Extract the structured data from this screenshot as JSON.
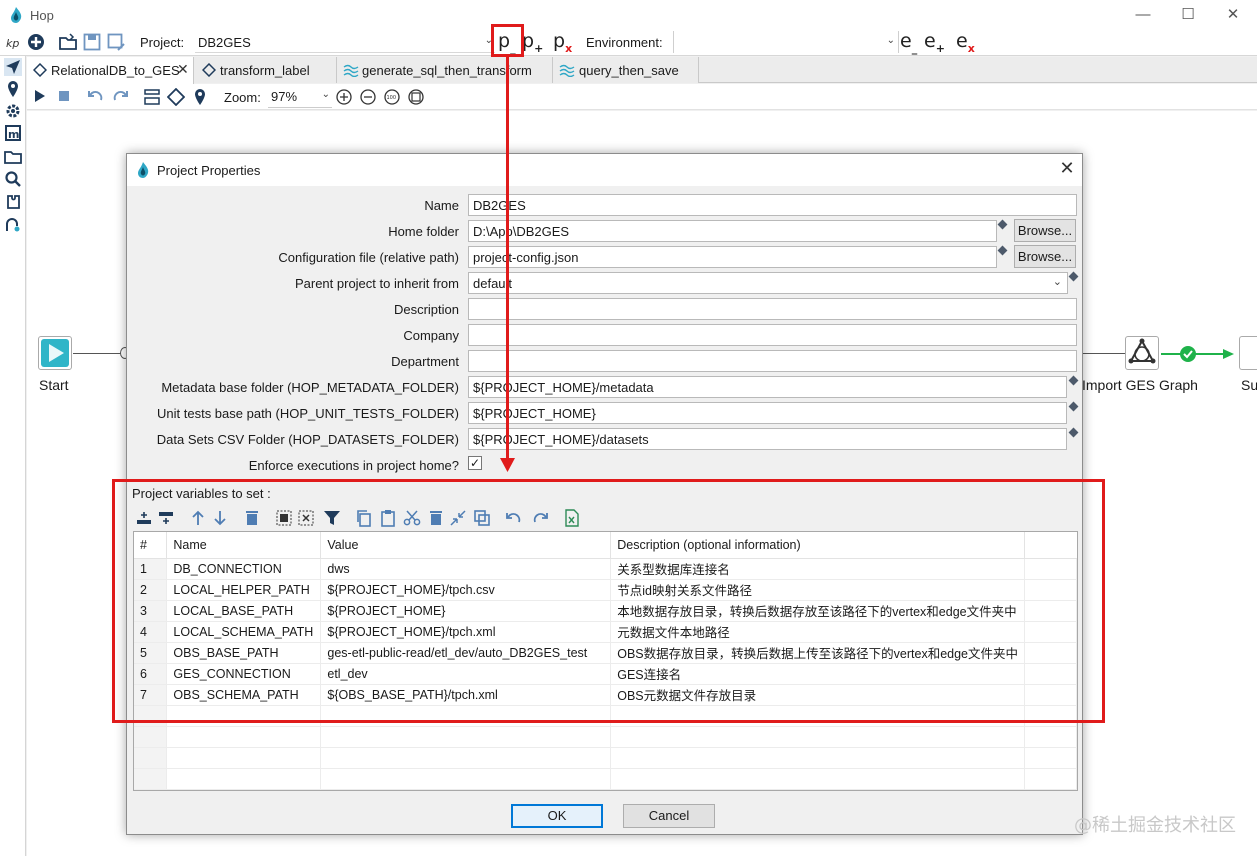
{
  "app": {
    "title": "Hop"
  },
  "toolbar": {
    "project_label": "Project:",
    "project_value": "DB2GES",
    "environment_label": "Environment:",
    "environment_value": "",
    "project_buttons": [
      {
        "letter": "p",
        "sub": "_"
      },
      {
        "letter": "p",
        "sub": "+"
      },
      {
        "letter": "p",
        "sub": "x"
      }
    ],
    "env_buttons": [
      {
        "letter": "e",
        "sub": "_"
      },
      {
        "letter": "e",
        "sub": "+"
      },
      {
        "letter": "e",
        "sub": "x"
      }
    ]
  },
  "tabs": [
    {
      "label": "RelationalDB_to_GES",
      "icon": "pipeline-icon",
      "active": true
    },
    {
      "label": "transform_label",
      "icon": "pipeline-icon",
      "active": false
    },
    {
      "label": "generate_sql_then_transform",
      "icon": "workflow-icon",
      "active": false
    },
    {
      "label": "query_then_save",
      "icon": "workflow-icon",
      "active": false
    }
  ],
  "canvas_toolbar": {
    "zoom_label": "Zoom:",
    "zoom_value": "97%"
  },
  "canvas": {
    "start_label": "Start",
    "import_label": "Import GES Graph",
    "next_label": "Su"
  },
  "dialog": {
    "title": "Project Properties",
    "fields": {
      "name": {
        "label": "Name",
        "value": "DB2GES"
      },
      "home_folder": {
        "label": "Home folder",
        "value": "D:\\App\\DB2GES"
      },
      "config_file": {
        "label": "Configuration file (relative path)",
        "value": "project-config.json"
      },
      "parent_project": {
        "label": "Parent project to inherit from",
        "value": "default"
      },
      "description": {
        "label": "Description",
        "value": ""
      },
      "company": {
        "label": "Company",
        "value": ""
      },
      "department": {
        "label": "Department",
        "value": ""
      },
      "metadata_folder": {
        "label": "Metadata base folder (HOP_METADATA_FOLDER)",
        "value": "${PROJECT_HOME}/metadata"
      },
      "unit_tests_folder": {
        "label": "Unit tests base path (HOP_UNIT_TESTS_FOLDER)",
        "value": "${PROJECT_HOME}"
      },
      "datasets_folder": {
        "label": "Data Sets CSV Folder (HOP_DATASETS_FOLDER)",
        "value": "${PROJECT_HOME}/datasets"
      },
      "enforce": {
        "label": "Enforce executions in project home?",
        "checked": true
      }
    },
    "browse_label": "Browse...",
    "variables_label": "Project variables to set :",
    "table": {
      "headers": [
        "#",
        "Name",
        "Value",
        "Description (optional information)"
      ],
      "rows": [
        [
          "1",
          "DB_CONNECTION",
          "dws",
          "关系型数据库连接名"
        ],
        [
          "2",
          "LOCAL_HELPER_PATH",
          "${PROJECT_HOME}/tpch.csv",
          "节点id映射关系文件路径"
        ],
        [
          "3",
          "LOCAL_BASE_PATH",
          "${PROJECT_HOME}",
          "本地数据存放目录，转换后数据存放至该路径下的vertex和edge文件夹中"
        ],
        [
          "4",
          "LOCAL_SCHEMA_PATH",
          "${PROJECT_HOME}/tpch.xml",
          "元数据文件本地路径"
        ],
        [
          "5",
          "OBS_BASE_PATH",
          "ges-etl-public-read/etl_dev/auto_DB2GES_test",
          "OBS数据存放目录，转换后数据上传至该路径下的vertex和edge文件夹中"
        ],
        [
          "6",
          "GES_CONNECTION",
          "etl_dev",
          "GES连接名"
        ],
        [
          "7",
          "OBS_SCHEMA_PATH",
          "${OBS_BASE_PATH}/tpch.xml",
          "OBS元数据文件存放目录"
        ]
      ],
      "empty_rows": 4
    },
    "ok_label": "OK",
    "cancel_label": "Cancel"
  },
  "watermark": "@稀土掘金技术社区",
  "colors": {
    "annotation_red": "#e01b1b",
    "accent_blue": "#0078d7",
    "hop_teal": "#2fa7c6",
    "success_green": "#1fb24a"
  }
}
